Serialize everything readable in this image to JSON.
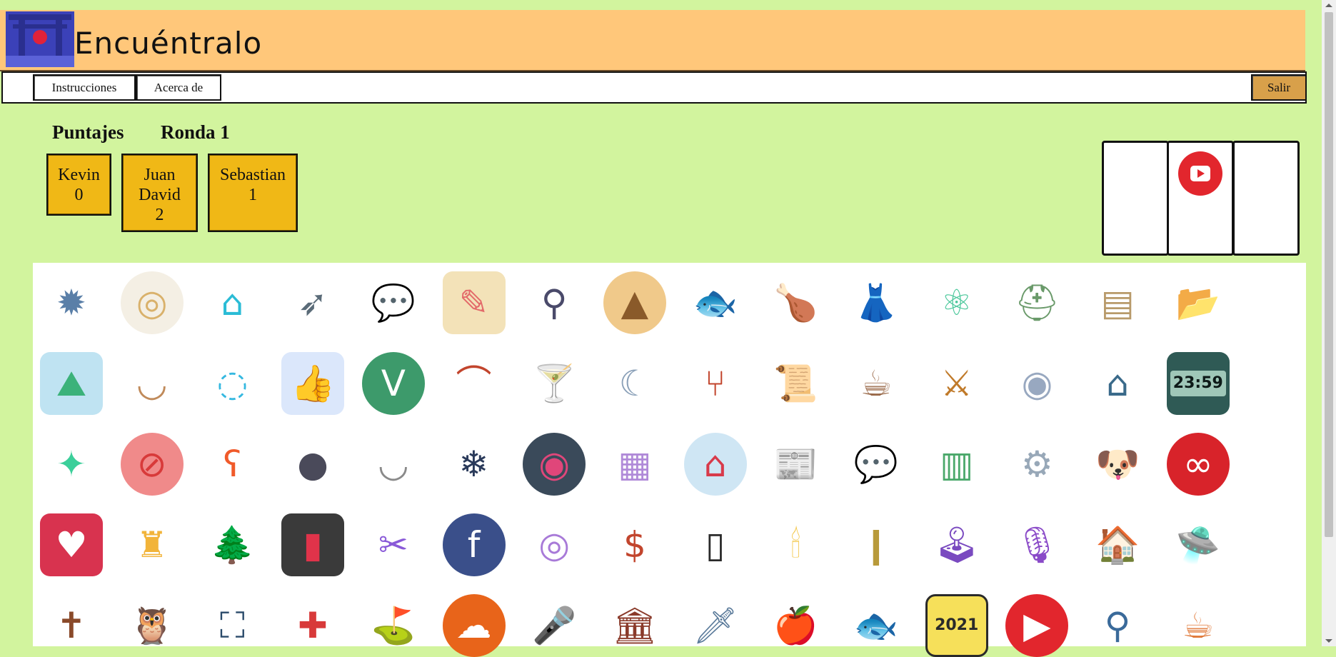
{
  "app": {
    "title": "Encuéntralo",
    "logo_icon": "torii-gate-logo-icon"
  },
  "nav": {
    "instructions": "Instrucciones",
    "about": "Acerca de",
    "exit": "Salir"
  },
  "scores": {
    "title": "Puntajes",
    "round": "Ronda 1",
    "players": [
      {
        "name": "Kevin",
        "points": "0"
      },
      {
        "name": "Juan David",
        "points": "2"
      },
      {
        "name": "Sebastian",
        "points": "1"
      }
    ]
  },
  "reveal_cards": [
    "",
    "youtube-icon",
    ""
  ],
  "colors": {
    "background": "#d2f49e",
    "header": "#ffc77a",
    "score_card": "#f0b816",
    "exit_button": "#d8a04a"
  },
  "board": {
    "rows": [
      [
        "mace-icon",
        "dumplings-plate-icon",
        "space-colony-icon",
        "bow-and-arrow-icon",
        "chat-bubbles-icon",
        "document-edit-icon",
        "hook-icon",
        "nachos-plate-icon",
        "clownfish-icon",
        "roast-chicken-icon",
        "red-dress-icon",
        "planet-atom-icon",
        "helmet-icon",
        "crate-icon",
        "open-folder-icon"
      ],
      [
        "landscape-app-icon",
        "soup-bowl-icon",
        "portal-ring-icon",
        "profile-like-icon",
        "vine-icon",
        "sausages-icon",
        "cocktail-icon",
        "moon-flag-icon",
        "sausage-fork-icon",
        "scroll-icon",
        "coffee-cup-icon",
        "katana-icon",
        "galaxy-icon",
        "range-hood-icon",
        "digital-clock-icon"
      ],
      [
        "space-station-icon",
        "no-asparagus-icon",
        "bear-chat-icon",
        "cannon-icon",
        "soup-bowl-2-icon",
        "snowflake-icon",
        "vinyl-record-icon",
        "flowchart-icon",
        "snow-globe-icon",
        "news-pages-icon",
        "chat-bubbles-2-icon",
        "leaning-tower-icon",
        "moon-rover-icon",
        "dog-icon",
        "lastfm-icon"
      ],
      [
        "heart-rate-app-icon",
        "castle-icon",
        "shopping-bag-tree-icon",
        "color-tv-icon",
        "film-cut-icon",
        "facebook-icon",
        "wormhole-icon",
        "bank-icon",
        "remote-control-icon",
        "candle-icon",
        "bullet-icon",
        "joystick-icon",
        "podcast-icon",
        "house-icon",
        "ufo-icon"
      ],
      [
        "coffin-icon",
        "owl-icon",
        "cheese-grater-icon",
        "hospital-icon",
        "bunting-flags-icon",
        "soundcloud-icon",
        "microphone-book-icon",
        "town-hall-icon",
        "sword-icon",
        "apple-icon",
        "fish-crate-icon",
        "calendar-2021-icon",
        "youtube-icon",
        "bottle-opener-icon",
        "coffee-to-go-icon"
      ]
    ],
    "calendar_label": "2021",
    "clock_label": "23:59"
  }
}
